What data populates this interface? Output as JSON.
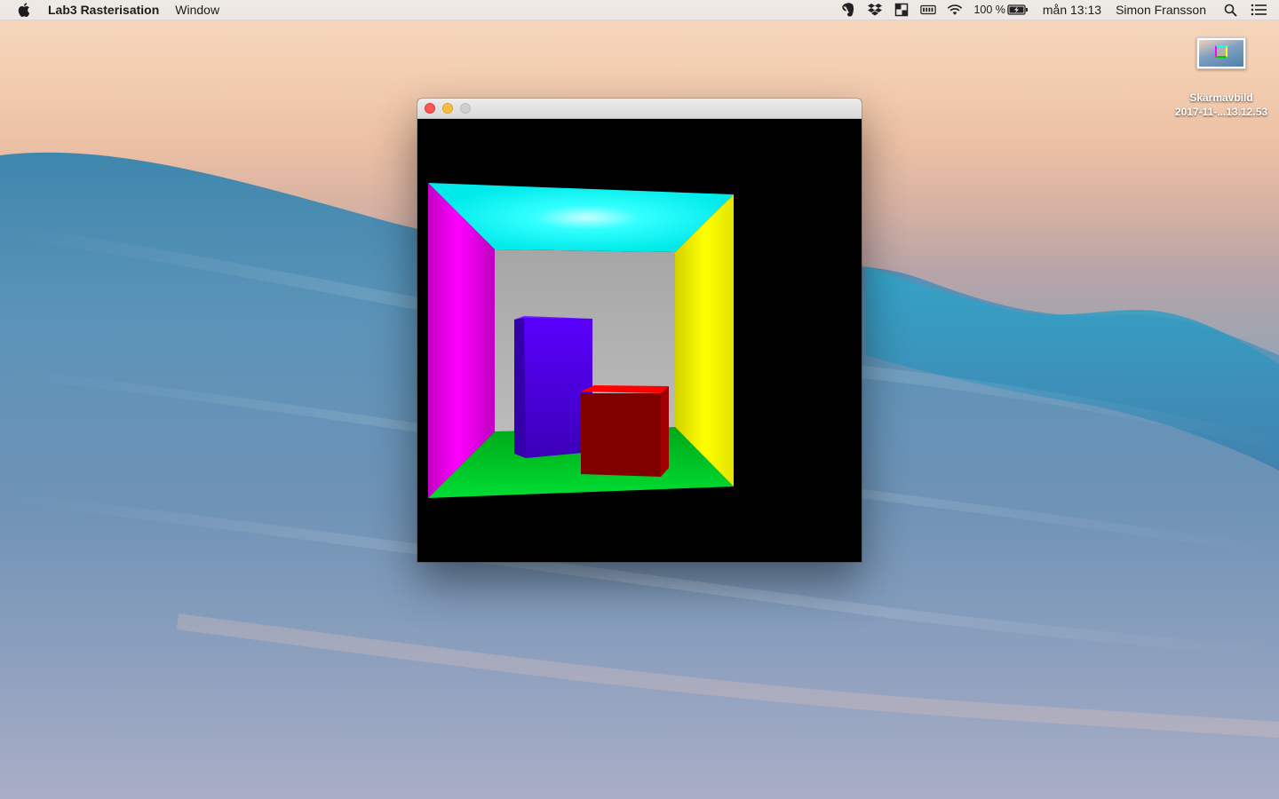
{
  "menubar": {
    "app_name": "Lab3 Rasterisation",
    "menus": [
      "Window"
    ],
    "battery_percent": "100 %",
    "clock": "mån 13:13",
    "user": "Simon Fransson"
  },
  "window": {
    "title": ""
  },
  "desktop": {
    "file_name": "Skärmavbild",
    "file_date": "2017-11-...13.12.53"
  },
  "scene": {
    "colors": {
      "ceiling": "#00ffff",
      "left_wall": "#ff00ff",
      "right_wall": "#ffff00",
      "back_wall": "#a8a8a8",
      "floor": "#00cc22",
      "tall_box": "#5500ff",
      "short_box": "#800000"
    }
  }
}
